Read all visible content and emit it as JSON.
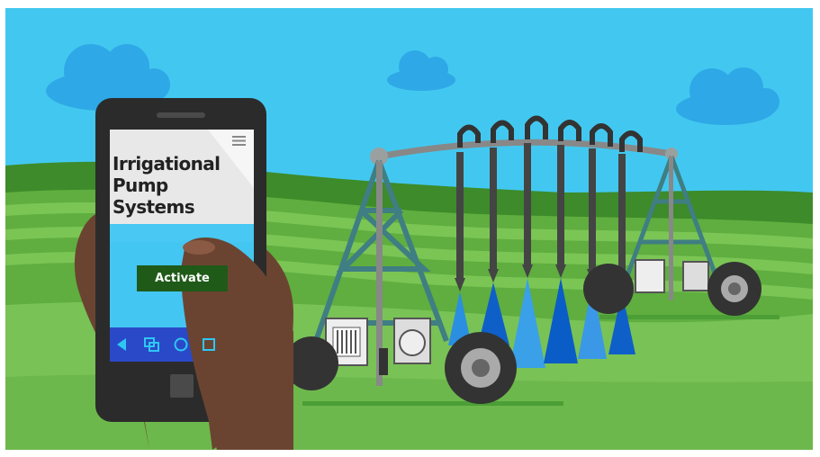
{
  "app": {
    "title_line1": "Irrigational",
    "title_line2": "Pump Systems",
    "activate_label": "Activate"
  },
  "nav_bar": {
    "icons": [
      "back-icon",
      "recent-apps-icon",
      "home-icon",
      "square-icon"
    ]
  },
  "colors": {
    "sky": "#42c8f0",
    "cloud": "#2ea8e6",
    "field_light": "#79c256",
    "field_dark": "#3d8b2a",
    "button": "#1f5a18",
    "nav_bar": "#2a49c9",
    "phone_body": "#2b2b2b",
    "water": "#1e78d8"
  }
}
